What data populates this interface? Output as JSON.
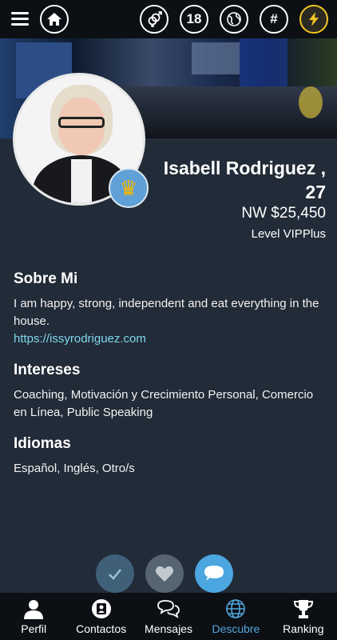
{
  "topbar": {
    "age_label": "18",
    "hashtag_label": "#"
  },
  "profile": {
    "name": "Isabell Rodriguez ,",
    "age": "27",
    "net_worth": "NW $25,450",
    "level": "Level VIPPlus"
  },
  "about": {
    "heading": "Sobre Mi",
    "text": "I am happy, strong, independent and eat everything in the house.",
    "link": "https://issyrodriguez.com"
  },
  "interests": {
    "heading": "Intereses",
    "text": "Coaching, Motivación y Crecimiento Personal, Comercio en Línea, Public Speaking"
  },
  "languages": {
    "heading": "Idiomas",
    "text": "Español, Inglés, Otro/s"
  },
  "nav": {
    "items": [
      {
        "label": "Perfil",
        "icon": "person-icon"
      },
      {
        "label": "Contactos",
        "icon": "contacts-icon"
      },
      {
        "label": "Mensajes",
        "icon": "messages-icon"
      },
      {
        "label": "Descubre",
        "icon": "globe-icon"
      },
      {
        "label": "Ranking",
        "icon": "trophy-icon"
      }
    ],
    "active": "Descubre"
  },
  "colors": {
    "background": "#222b38",
    "bar": "#0c0f14",
    "accent": "#53a6dc",
    "link": "#7fd7ee",
    "bolt": "#f3c623"
  }
}
